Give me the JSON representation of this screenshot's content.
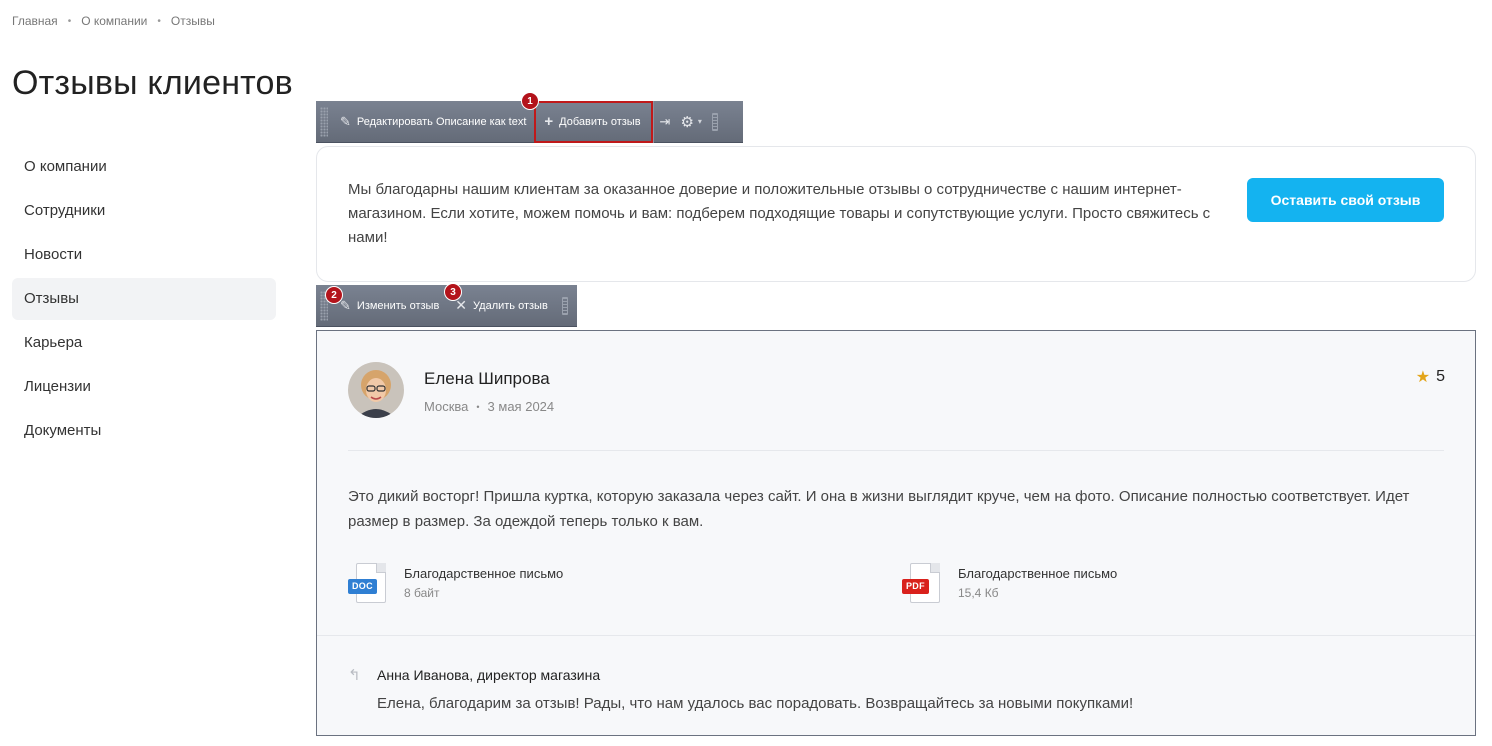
{
  "breadcrumb": [
    "Главная",
    "О компании",
    "Отзывы"
  ],
  "page_title": "Отзывы клиентов",
  "sidebar": {
    "items": [
      {
        "label": "О компании"
      },
      {
        "label": "Сотрудники"
      },
      {
        "label": "Новости"
      },
      {
        "label": "Отзывы"
      },
      {
        "label": "Карьера"
      },
      {
        "label": "Лицензии"
      },
      {
        "label": "Документы"
      }
    ]
  },
  "admin_toolbar_top": {
    "edit_label": "Редактировать Описание как text",
    "add_label": "Добавить отзыв",
    "badge_add": "1"
  },
  "admin_toolbar_review": {
    "edit_label": "Изменить отзыв",
    "delete_label": "Удалить отзыв",
    "badge_edit": "2",
    "badge_delete": "3"
  },
  "intro": {
    "text": "Мы благодарны нашим клиентам за оказанное доверие и положительные отзывы о сотрудничестве с нашим интернет-магазином. Если хотите, можем помочь и вам: подберем подходящие товары и сопутствующие услуги. Просто свяжитесь с нами!",
    "button_label": "Оставить свой отзыв"
  },
  "review": {
    "author": "Елена Шипрова",
    "city": "Москва",
    "date": "3 мая 2024",
    "rating": "5",
    "text": "Это дикий восторг! Пришла куртка, которую заказала через сайт. И она в жизни выглядит круче, чем на фото. Описание полностью соответствует. Идет размер в размер. За одеждой теперь только к вам.",
    "files": [
      {
        "type": "DOC",
        "name": "Благодарственное письмо",
        "size": "8 байт",
        "color": "#2f7fd3"
      },
      {
        "type": "PDF",
        "name": "Благодарственное письмо",
        "size": "15,4 Кб",
        "color": "#d9211c"
      }
    ],
    "answer": {
      "author": "Анна Иванова, директор магазина",
      "text": "Елена, благодарим за отзыв! Рады, что нам удалось вас порадовать. Возвращайтесь за новыми покупками!"
    }
  },
  "colors": {
    "accent": "#14b3f0",
    "badge": "#b3131b",
    "star": "#e3a51a"
  }
}
